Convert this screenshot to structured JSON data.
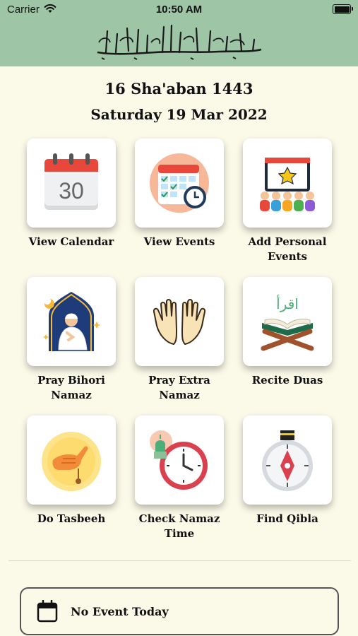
{
  "status_bar": {
    "carrier": "Carrier",
    "time": "10:50 AM"
  },
  "header": {
    "bismillah": "بِسْمِ ٱللَّٰهِ ٱلرَّحْمَٰنِ ٱلرَّحِيمِ"
  },
  "dates": {
    "hijri": "16 Sha'aban 1443",
    "gregorian": "Saturday 19 Mar 2022"
  },
  "menu": {
    "view_calendar": {
      "label": "View Calendar",
      "icon": "calendar-icon",
      "day": "30"
    },
    "view_events": {
      "label": "View Events",
      "icon": "schedule-clock-icon"
    },
    "add_personal_events": {
      "label": "Add Personal Events",
      "icon": "event-people-icon"
    },
    "pray_bihori_namaz": {
      "label": "Pray Bihori Namaz",
      "icon": "praying-man-icon"
    },
    "pray_extra_namaz": {
      "label": "Pray Extra Namaz",
      "icon": "praying-hands-icon"
    },
    "recite_duas": {
      "label": "Recite Duas",
      "icon": "quran-stand-icon",
      "arabic": "اقرأ"
    },
    "do_tasbeeh": {
      "label": "Do Tasbeeh",
      "icon": "tasbeeh-icon"
    },
    "check_namaz_time": {
      "label": "Check Namaz Time",
      "icon": "mosque-clock-icon"
    },
    "find_qibla": {
      "label": "Find Qibla",
      "icon": "qibla-compass-icon"
    }
  },
  "event_bar": {
    "text": "No Event Today",
    "icon": "calendar-outline-icon"
  },
  "colors": {
    "header": "#9ec6a6",
    "background": "#fbf9e8",
    "calendar_red": "#e8473b"
  }
}
